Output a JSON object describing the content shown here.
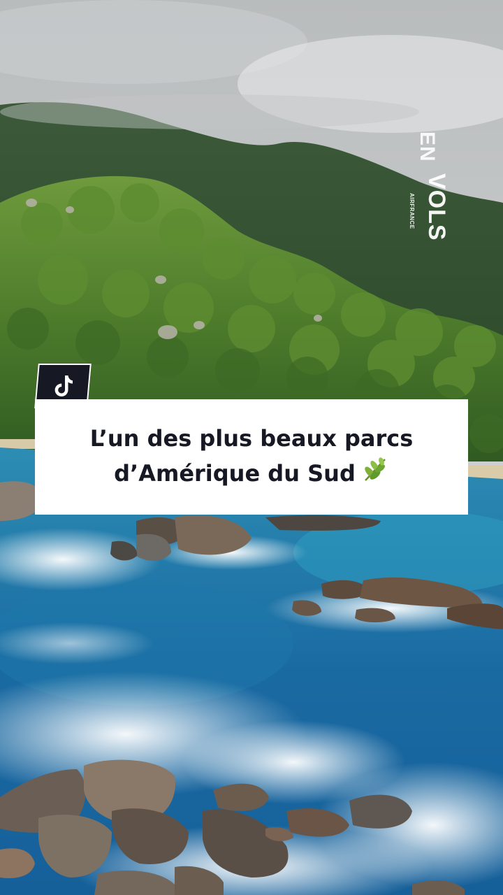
{
  "watermark": {
    "brand_en": "EN",
    "brand_vols": "VOLS",
    "airline": "AIRFRANCE"
  },
  "badge": {
    "icon": "tiktok-logo-icon"
  },
  "caption": {
    "line1": "L’un des plus beaux parcs",
    "line2": "d’Amérique du Sud",
    "emoji": "herb-emoji-icon"
  },
  "colors": {
    "badge_bg": "#161823",
    "caption_bg": "#ffffff",
    "caption_text": "#161823"
  }
}
